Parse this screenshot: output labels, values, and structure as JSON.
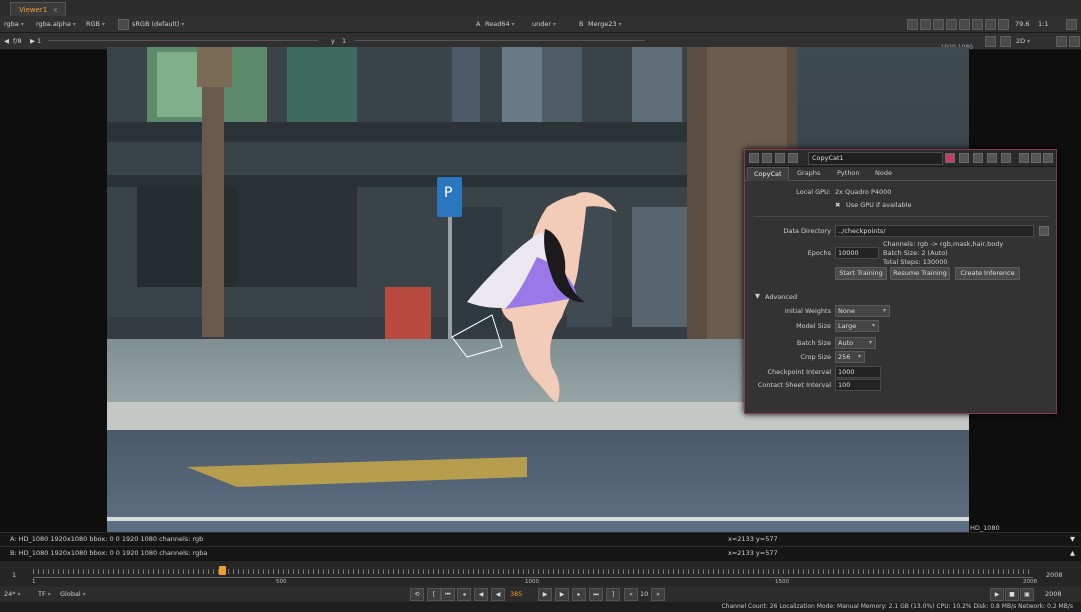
{
  "viewer_tab": {
    "label": "Viewer1",
    "close": "x"
  },
  "toolbar1": {
    "channels": "rgba",
    "alpha": "rgba.alpha",
    "colorspace_short": "RGB",
    "lut": "sRGB (default)",
    "input_a_label": "A",
    "input_a": "Read64",
    "operation": "under",
    "input_b_label": "B",
    "input_b": "Merge23",
    "zoom": "79.6",
    "ratio": "1:1"
  },
  "toolbar2": {
    "fstop": "f/8",
    "fstop_value": "1",
    "y_label": "y",
    "y_value": "1",
    "view_mode": "2D"
  },
  "viewer": {
    "format_top": "1920,1080",
    "format_bottom": "HD_1080"
  },
  "info": {
    "a": {
      "text": "A:  HD_1080 1920x1080  bbox: 0 0 1920 1080 channels: rgb",
      "coords": "x=2133 y=577"
    },
    "b": {
      "text": "B:  HD_1080 1920x1080  bbox: 0 0 1920 1080 channels: rgba",
      "coords": "x=2133 y=577"
    }
  },
  "timeline": {
    "start": "1",
    "end": "2008",
    "labels": [
      "1",
      "500",
      "1000",
      "1500",
      "2008"
    ]
  },
  "transport": {
    "fps": "24*",
    "tf": "TF",
    "scope": "Global",
    "frame": "385",
    "increment": "10",
    "end_frame": "2008"
  },
  "status": {
    "text": "Channel Count: 26  Localization Mode: Manual  Memory: 2.1 GB (13.0%)  CPU: 10.2%  Disk: 0.8 MB/s  Network: 0.2 MB/s"
  },
  "panel": {
    "node_name": "CopyCat1",
    "tabs": [
      "CopyCat",
      "Graphs",
      "Python",
      "Node"
    ],
    "local_gpu_label": "Local GPU:",
    "local_gpu_value": "2x Quadro P4000",
    "use_gpu_label": "Use GPU if available",
    "data_directory_label": "Data Directory",
    "data_directory_value": "../checkpoints/",
    "epochs_label": "Epochs",
    "epochs_value": "10000",
    "channels_info": "Channels: rgb -> rgb,mask,hair,body",
    "batch_info": "Batch Size: 2 (Auto)",
    "steps_info": "Total Steps: 130000",
    "start_training": "Start Training",
    "resume_training": "Resume Training",
    "create_inference": "Create Inference",
    "advanced_label": "Advanced",
    "initial_weights_label": "Initial Weights",
    "initial_weights_value": "None",
    "model_size_label": "Model Size",
    "model_size_value": "Large",
    "batch_size_label": "Batch Size",
    "batch_size_value": "Auto",
    "crop_size_label": "Crop Size",
    "crop_size_value": "256",
    "checkpoint_interval_label": "Checkpoint Interval",
    "checkpoint_interval_value": "1000",
    "contact_sheet_interval_label": "Contact Sheet Interval",
    "contact_sheet_interval_value": "100"
  },
  "colors": {
    "accent": "#f0a030",
    "panel_border": "#8a3a50",
    "overlay_purple": "#9a78e8"
  }
}
